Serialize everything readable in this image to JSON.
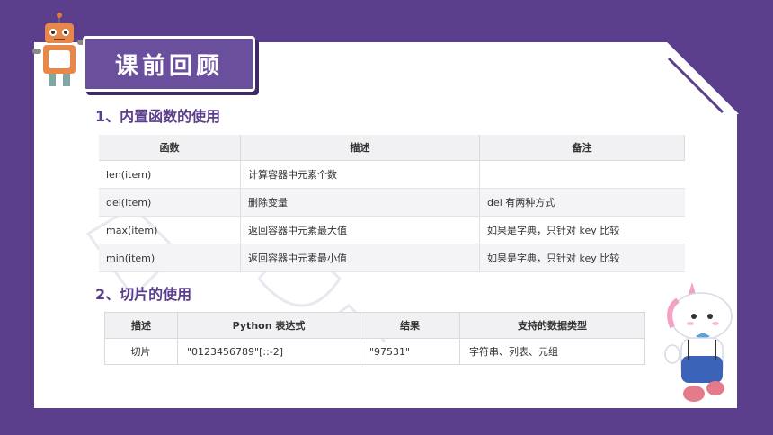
{
  "header": {
    "title": "课前回顾"
  },
  "section1": {
    "title": "1、内置函数的使用",
    "columns": [
      "函数",
      "描述",
      "备注"
    ],
    "rows": [
      [
        "len(item)",
        "计算容器中元素个数",
        ""
      ],
      [
        "del(item)",
        "删除变量",
        "del 有两种方式"
      ],
      [
        "max(item)",
        "返回容器中元素最大值",
        "如果是字典，只针对 key 比较"
      ],
      [
        "min(item)",
        "返回容器中元素最小值",
        "如果是字典，只针对 key 比较"
      ]
    ]
  },
  "section2": {
    "title": "2、切片的使用",
    "columns": [
      "描述",
      "Python 表达式",
      "结果",
      "支持的数据类型"
    ],
    "rows": [
      [
        "切片",
        "\"0123456789\"[::-2]",
        "\"97531\"",
        "字符串、列表、元组"
      ]
    ]
  },
  "colors": {
    "background": "#5b3f8c",
    "badge": "#6a4f9c",
    "heading": "#5b3f8c"
  },
  "icons": {
    "top_left": "robot-mascot-icon",
    "bottom_right": "unicorn-mascot-icon"
  }
}
